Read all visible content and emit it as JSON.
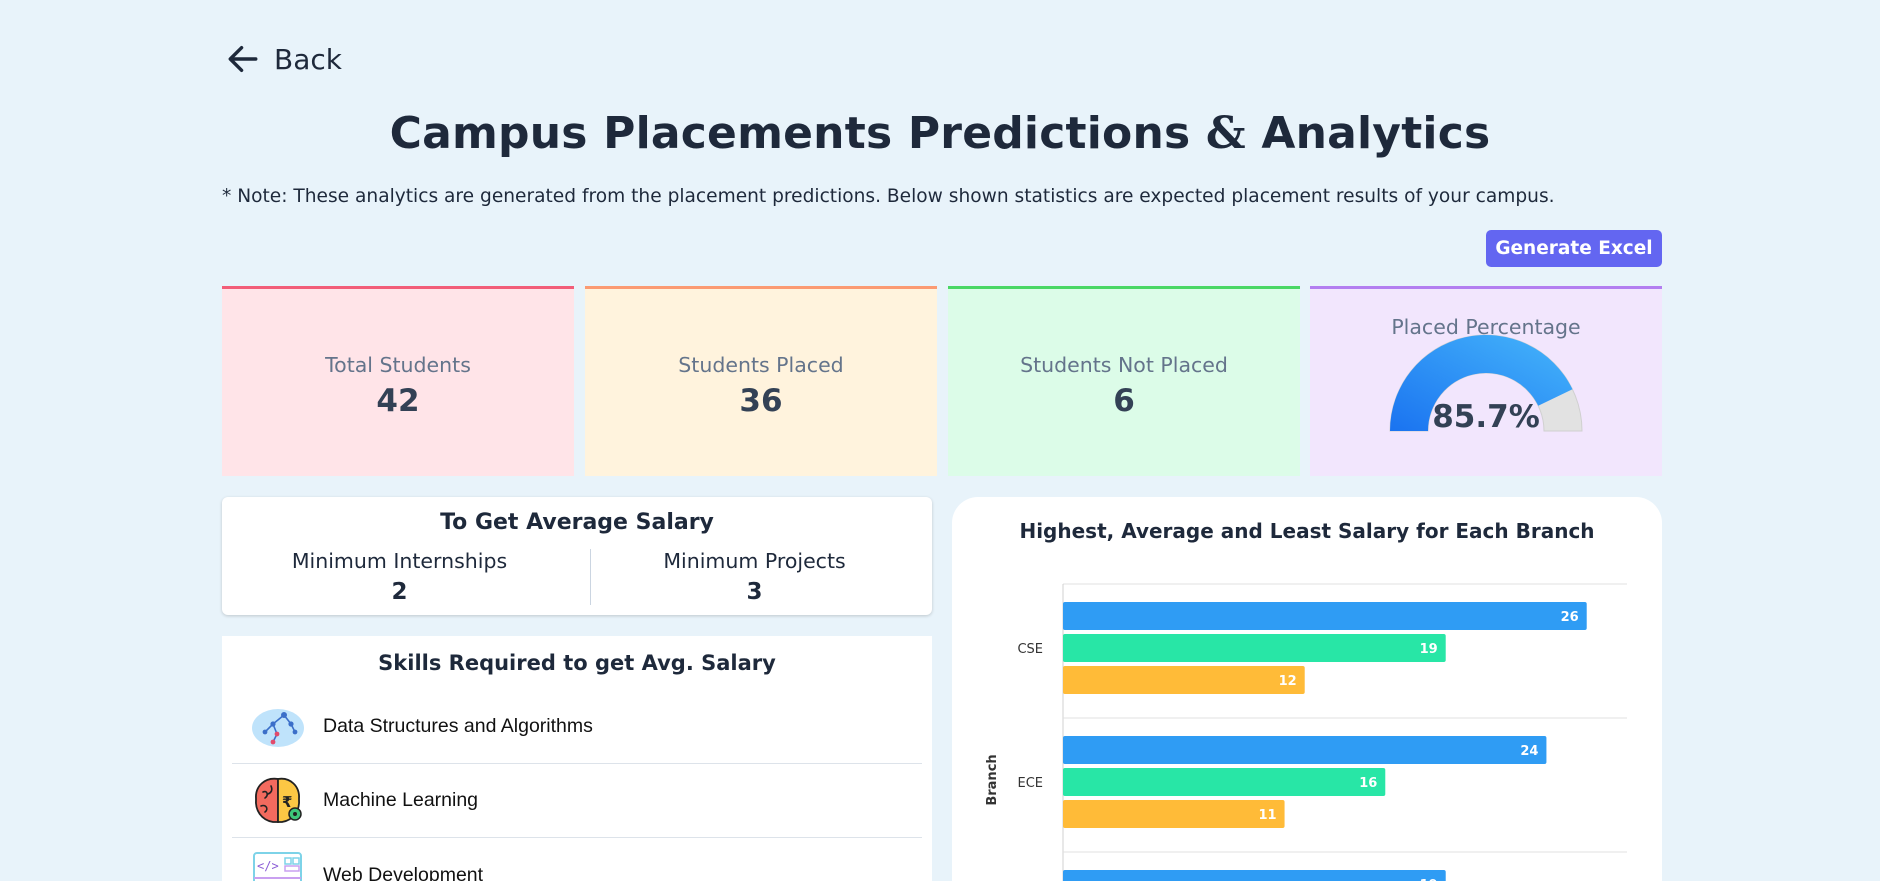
{
  "nav": {
    "back_label": "Back"
  },
  "header": {
    "title_part1": "Campus Placements Predictions",
    "title_amp": "&",
    "title_part2": "Analytics",
    "note": "* Note: These analytics are generated from the placement predictions. Below shown statistics are expected placement results of your campus."
  },
  "toolbar": {
    "generate_label": "Generate Excel"
  },
  "stats": {
    "total": {
      "label": "Total Students",
      "value": "42"
    },
    "placed": {
      "label": "Students Placed",
      "value": "36"
    },
    "not_placed": {
      "label": "Students Not Placed",
      "value": "6"
    },
    "percentage": {
      "label": "Placed Percentage",
      "value": "85.7%",
      "fraction": 0.857
    }
  },
  "avg_salary": {
    "title": "To Get Average Salary",
    "internships_label": "Minimum Internships",
    "internships_value": "2",
    "projects_label": "Minimum Projects",
    "projects_value": "3"
  },
  "skills": {
    "title": "Skills Required to get Avg. Salary",
    "items": [
      {
        "label": "Data Structures and Algorithms",
        "icon": "dsa-tree-icon"
      },
      {
        "label": "Machine Learning",
        "icon": "brain-icon"
      },
      {
        "label": "Web Development",
        "icon": "web-code-icon"
      }
    ]
  },
  "colors": {
    "highest": "#2f9cf4",
    "average": "#28e6a6",
    "least": "#ffbb38",
    "accent": "#6366f1"
  },
  "chart_data": {
    "type": "bar",
    "orientation": "horizontal",
    "title": "Highest, Average and Least Salary for Each Branch",
    "ylabel": "Branch",
    "xlim": [
      0,
      28
    ],
    "categories": [
      "CSE",
      "ECE",
      ""
    ],
    "series": [
      {
        "values": [
          26,
          24,
          19
        ]
      },
      {
        "values": [
          19,
          16,
          null
        ]
      },
      {
        "values": [
          12,
          11,
          null
        ]
      }
    ]
  }
}
